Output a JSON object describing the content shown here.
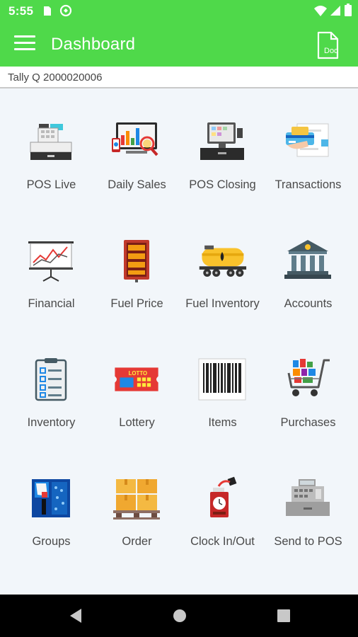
{
  "status_bar": {
    "time": "5:55",
    "icons": [
      "sim-card-icon",
      "sync-icon",
      "wifi-icon",
      "signal-icon",
      "battery-icon"
    ]
  },
  "app_bar": {
    "title": "Dashboard",
    "doc_icon_text": "Doc"
  },
  "subheader": {
    "text": "Tally Q 2000020006"
  },
  "tiles": [
    {
      "label": "POS Live",
      "icon": "cash-register-icon"
    },
    {
      "label": "Daily Sales",
      "icon": "sales-report-icon"
    },
    {
      "label": "POS Closing",
      "icon": "pos-terminal-icon"
    },
    {
      "label": "Transactions",
      "icon": "credit-card-icon"
    },
    {
      "label": "Financial",
      "icon": "chart-board-icon"
    },
    {
      "label": "Fuel Price",
      "icon": "fuel-price-sign-icon"
    },
    {
      "label": "Fuel Inventory",
      "icon": "tanker-icon"
    },
    {
      "label": "Accounts",
      "icon": "bank-icon"
    },
    {
      "label": "Inventory",
      "icon": "checklist-icon"
    },
    {
      "label": "Lottery",
      "icon": "lottery-ticket-icon"
    },
    {
      "label": "Items",
      "icon": "barcode-icon"
    },
    {
      "label": "Purchases",
      "icon": "shopping-cart-icon"
    },
    {
      "label": "Groups",
      "icon": "groups-icon"
    },
    {
      "label": "Order",
      "icon": "boxes-pallet-icon"
    },
    {
      "label": "Clock In/Out",
      "icon": "time-clock-icon"
    },
    {
      "label": "Send to POS",
      "icon": "send-register-icon"
    }
  ],
  "colors": {
    "accent": "#4fd94a",
    "background": "#f2f6fa",
    "label": "#4a4a4a"
  },
  "lottery_ticket_text": "LOTTO"
}
